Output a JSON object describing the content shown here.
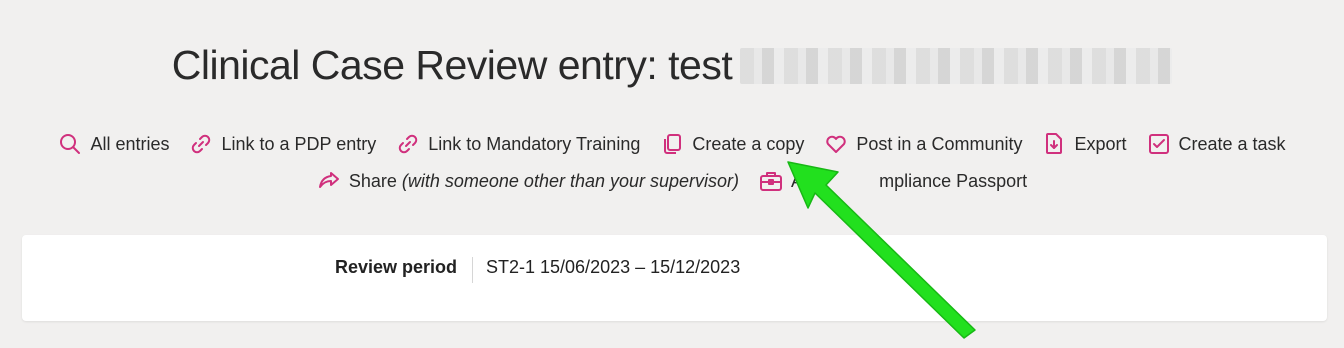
{
  "header": {
    "title": "Clinical Case Review entry: test"
  },
  "actions_row1": [
    {
      "label": "All entries",
      "icon": "search-icon"
    },
    {
      "label": "Link to a PDP entry",
      "icon": "link-icon"
    },
    {
      "label": "Link to Mandatory Training",
      "icon": "link-icon"
    },
    {
      "label": "Create a copy",
      "icon": "copy-icon"
    },
    {
      "label": "Post in a Community",
      "icon": "heart-icon"
    },
    {
      "label": "Export",
      "icon": "download-file-icon"
    },
    {
      "label": "Create a task",
      "icon": "checkbox-icon"
    }
  ],
  "actions_row2": {
    "share": {
      "label": "Share",
      "note": "(with someone other than your supervisor)",
      "icon": "share-arrow-icon"
    },
    "passport": {
      "label_visible_start": "Ad",
      "label_visible_end": "mpliance Passport",
      "icon": "briefcase-icon"
    }
  },
  "card": {
    "label": "Review period",
    "value": "ST2-1 15/06/2023 – 15/12/2023"
  },
  "colors": {
    "accent": "#d0307d",
    "annotation_arrow": "#22e01e",
    "background": "#f1f0ef"
  }
}
